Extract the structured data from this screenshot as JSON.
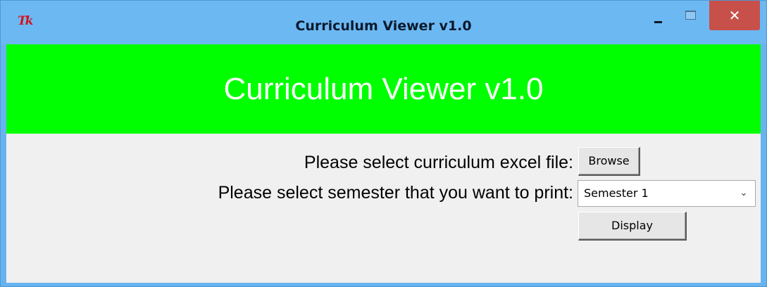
{
  "window": {
    "title": "Curriculum Viewer v1.0",
    "icon": "tk-icon",
    "icon_text": "Tk",
    "controls": {
      "minimize": "minimize-icon",
      "maximize": "maximize-icon",
      "close_glyph": "✕"
    }
  },
  "banner": {
    "title": "Curriculum Viewer v1.0",
    "background": "#00ff00",
    "text_color": "#ffffff"
  },
  "form": {
    "file_label": "Please select curriculum excel file:",
    "browse_label": "Browse",
    "semester_label": "Please select semester that you want to print:",
    "semester_selected": "Semester 1",
    "display_label": "Display"
  },
  "colors": {
    "titlebar": "#6cb8f3",
    "close_button": "#c7504a",
    "client_background": "#f0f0f0"
  }
}
